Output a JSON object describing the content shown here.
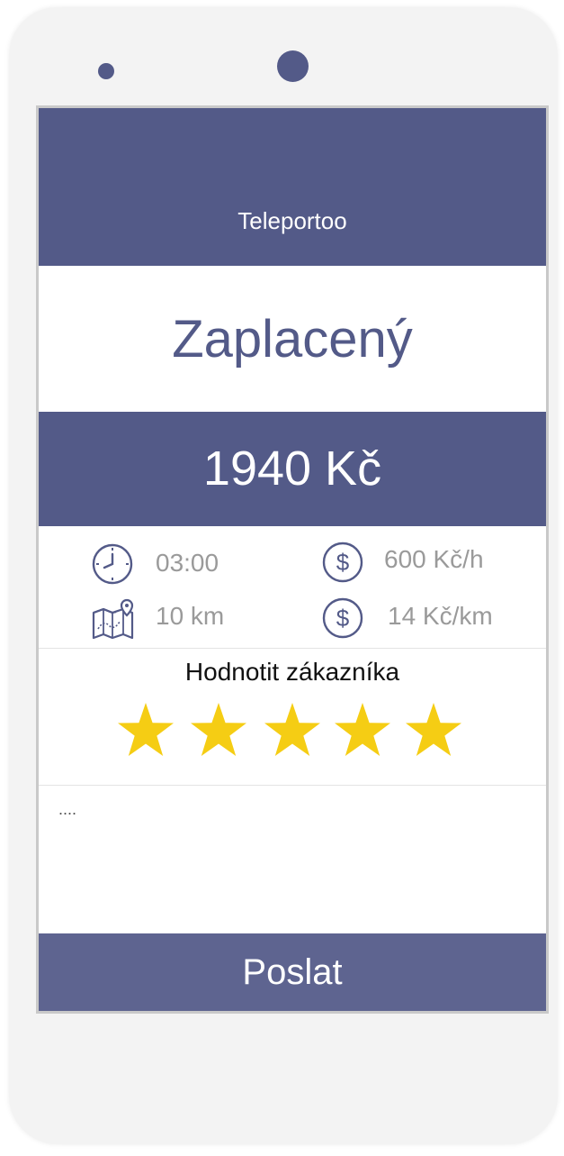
{
  "app": {
    "title": "Teleportoo"
  },
  "payment": {
    "status": "Zaplacený",
    "total": "1940 Kč"
  },
  "trip": {
    "duration": "03:00",
    "distance": "10 km",
    "rate_per_hour": "600 Kč/h",
    "rate_per_km": "14 Kč/km"
  },
  "rating": {
    "label": "Hodnotit zákazníka",
    "value": 5,
    "max": 5
  },
  "comment": {
    "placeholder": "....",
    "value": ""
  },
  "submit": {
    "label": "Poslat"
  },
  "icons": {
    "duration": "clock-icon",
    "distance": "map-pin-icon",
    "rate_per_hour": "dollar-coin-icon",
    "rate_per_km": "dollar-coin-icon"
  },
  "colors": {
    "primary": "#535a88",
    "button": "#5e6490",
    "star": "#f5cd14",
    "muted_text": "#9a9a9a"
  }
}
